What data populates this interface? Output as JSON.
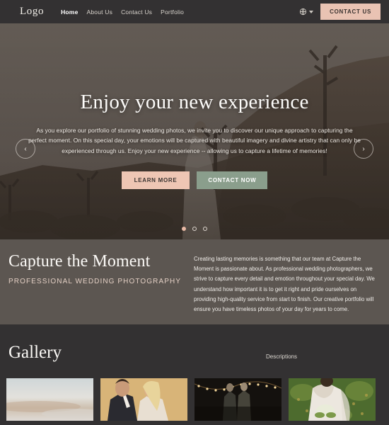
{
  "header": {
    "logo": "Logo",
    "nav": [
      {
        "label": "Home",
        "active": true
      },
      {
        "label": "About Us",
        "active": false
      },
      {
        "label": "Contact Us",
        "active": false
      },
      {
        "label": "Portfolio",
        "active": false
      }
    ],
    "language_icon": "globe-icon",
    "contact_button": "CONTACT US"
  },
  "hero": {
    "title": "Enjoy your new experience",
    "subtitle": "As you explore our portfolio of stunning wedding photos, we invite you to discover our unique approach to capturing the perfect moment. On this special day, your emotions will be captured with beautiful imagery and divine artistry that can only be experienced through us. Enjoy your new experience -- allowing us to capture a lifetime of memories!",
    "primary_button": "LEARN MORE",
    "secondary_button": "CONTACT NOW",
    "prev_arrow": "‹",
    "next_arrow": "›",
    "slides": 3,
    "active_slide": 1
  },
  "capture": {
    "title": "Capture the Moment",
    "kicker": "PROFESSIONAL WEDDING PHOTOGRAPHY",
    "body": "Creating lasting memories is something that our team at Capture the Moment is passionate about. As professional wedding photographers, we strive to capture every detail and emotion throughout your special day. We understand how important it is to get it right and pride ourselves on providing high-quality service from start to finish. Our creative portfolio will ensure you have timeless photos of your day for years to come."
  },
  "gallery": {
    "title": "Gallery",
    "descriptions_label": "Descriptions",
    "tiles": [
      {
        "name": "beach-wedding-photo"
      },
      {
        "name": "couple-portrait-photo"
      },
      {
        "name": "evening-lights-photo"
      },
      {
        "name": "bride-outdoor-photo"
      }
    ]
  },
  "colors": {
    "page_background": "#333132",
    "capture_background": "#5c5651",
    "accent_peach": "#e9c3b3",
    "accent_sage": "#8a9e8c",
    "text_light": "#f2efe9"
  }
}
